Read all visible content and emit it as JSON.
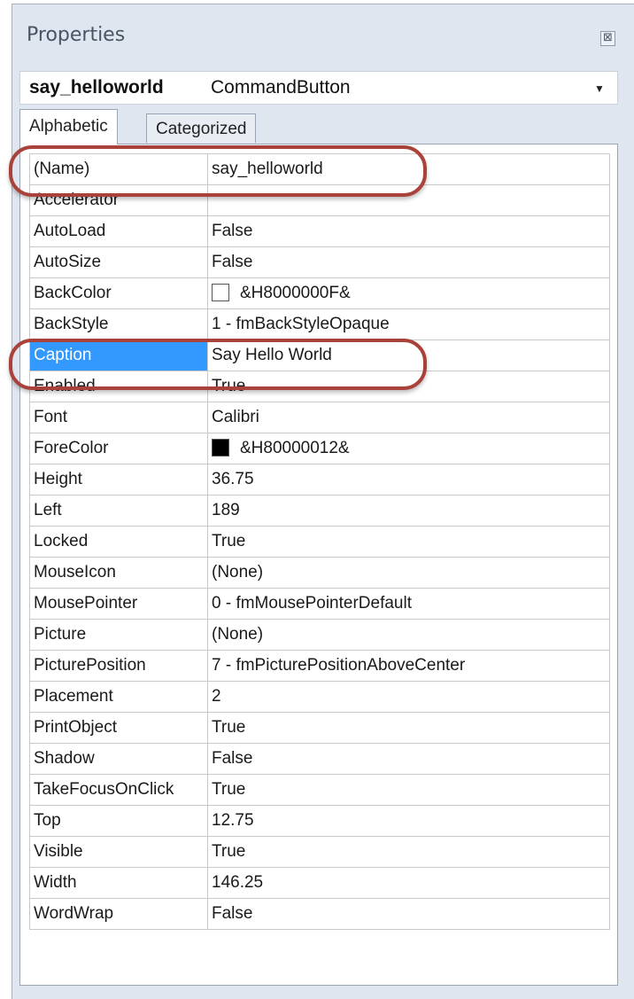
{
  "window": {
    "title": "Properties",
    "close_glyph": "⊠"
  },
  "object_selector": {
    "name": "say_helloworld",
    "type": "CommandButton",
    "dropdown_icon": "chevron-down-icon"
  },
  "tabs": [
    {
      "label": "Alphabetic",
      "active": true
    },
    {
      "label": "Categorized",
      "active": false
    }
  ],
  "properties": [
    {
      "name": "(Name)",
      "value": "say_helloworld"
    },
    {
      "name": "Accelerator",
      "value": ""
    },
    {
      "name": "AutoLoad",
      "value": "False"
    },
    {
      "name": "AutoSize",
      "value": "False"
    },
    {
      "name": "BackColor",
      "value": "&H8000000F&",
      "swatch": "#ffffff"
    },
    {
      "name": "BackStyle",
      "value": "1 - fmBackStyleOpaque"
    },
    {
      "name": "Caption",
      "value": "Say Hello World",
      "selected": true
    },
    {
      "name": "Enabled",
      "value": "True"
    },
    {
      "name": "Font",
      "value": "Calibri"
    },
    {
      "name": "ForeColor",
      "value": "&H80000012&",
      "swatch": "#000000"
    },
    {
      "name": "Height",
      "value": "36.75"
    },
    {
      "name": "Left",
      "value": "189"
    },
    {
      "name": "Locked",
      "value": "True"
    },
    {
      "name": "MouseIcon",
      "value": "(None)"
    },
    {
      "name": "MousePointer",
      "value": "0 - fmMousePointerDefault"
    },
    {
      "name": "Picture",
      "value": "(None)"
    },
    {
      "name": "PicturePosition",
      "value": "7 - fmPicturePositionAboveCenter"
    },
    {
      "name": "Placement",
      "value": "2"
    },
    {
      "name": "PrintObject",
      "value": "True"
    },
    {
      "name": "Shadow",
      "value": "False"
    },
    {
      "name": "TakeFocusOnClick",
      "value": "True"
    },
    {
      "name": "Top",
      "value": "12.75"
    },
    {
      "name": "Visible",
      "value": "True"
    },
    {
      "name": "Width",
      "value": "146.25"
    },
    {
      "name": "WordWrap",
      "value": "False"
    }
  ],
  "colors": {
    "selection": "#3399ff",
    "annotation_ring": "#a8423a"
  }
}
